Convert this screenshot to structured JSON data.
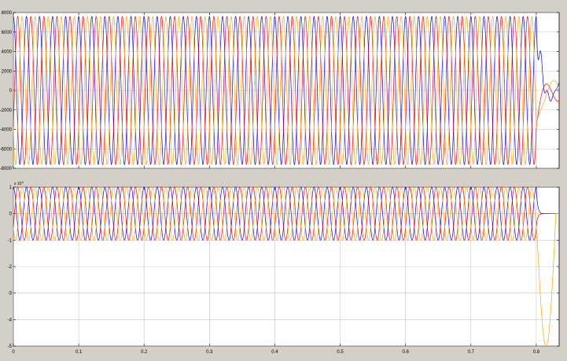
{
  "window": {
    "background_color": "#d4d0c8"
  },
  "chart_data": [
    {
      "type": "line",
      "title": "",
      "xlabel": "",
      "ylabel": "",
      "xlim": [
        0,
        0.835
      ],
      "ylim": [
        -8000,
        8000
      ],
      "y_ticks": [
        -8000,
        -6000,
        -4000,
        -2000,
        0,
        2000,
        4000,
        6000,
        8000
      ],
      "y_tick_labels": [
        "-8000",
        "-6000",
        "-4000",
        "-2000",
        "0",
        "2000",
        "4000",
        "6000",
        "8000"
      ],
      "x_ticks": [
        0,
        0.1,
        0.2,
        0.3,
        0.4,
        0.5,
        0.6,
        0.7,
        0.8
      ],
      "x_tick_labels": [],
      "grid": true,
      "frequency_hz": 50,
      "amplitude": 7600,
      "fault_time": 0.8,
      "series": [
        {
          "color": "#0000ff",
          "phase_deg": 90
        },
        {
          "color": "#ff0000",
          "phase_deg": -30
        },
        {
          "color": "#ffa500",
          "phase_deg": 210
        }
      ],
      "post_fault": {
        "amplitude": 1100,
        "transient_amplitude": 2600
      }
    },
    {
      "type": "line",
      "title": "",
      "xlabel": "",
      "ylabel": "",
      "xlim": [
        0,
        0.835
      ],
      "ylim": [
        -50000,
        10000
      ],
      "y_exponent_label": "x 10^4",
      "y_exponent_base": "x 10",
      "y_exponent_power": "4",
      "y_ticks": [
        -50000,
        -40000,
        -30000,
        -20000,
        -10000,
        0,
        10000
      ],
      "y_tick_labels": [
        "-5",
        "-4",
        "-3",
        "-2",
        "-1",
        "0",
        "1"
      ],
      "x_ticks": [
        0,
        0.1,
        0.2,
        0.3,
        0.4,
        0.5,
        0.6,
        0.7,
        0.8
      ],
      "x_tick_labels": [
        "0",
        "0.1",
        "0.2",
        "0.3",
        "0.4",
        "0.5",
        "0.6",
        "0.7",
        "0.8"
      ],
      "grid": true,
      "frequency_hz": 50,
      "amplitude": 10000,
      "fault_time": 0.8,
      "series": [
        {
          "color": "#0000ff",
          "phase_deg": 90
        },
        {
          "color": "#ff0000",
          "phase_deg": -30
        },
        {
          "color": "#ffa500",
          "phase_deg": 210
        }
      ],
      "post_fault": {
        "dip_min": -50000
      }
    }
  ]
}
